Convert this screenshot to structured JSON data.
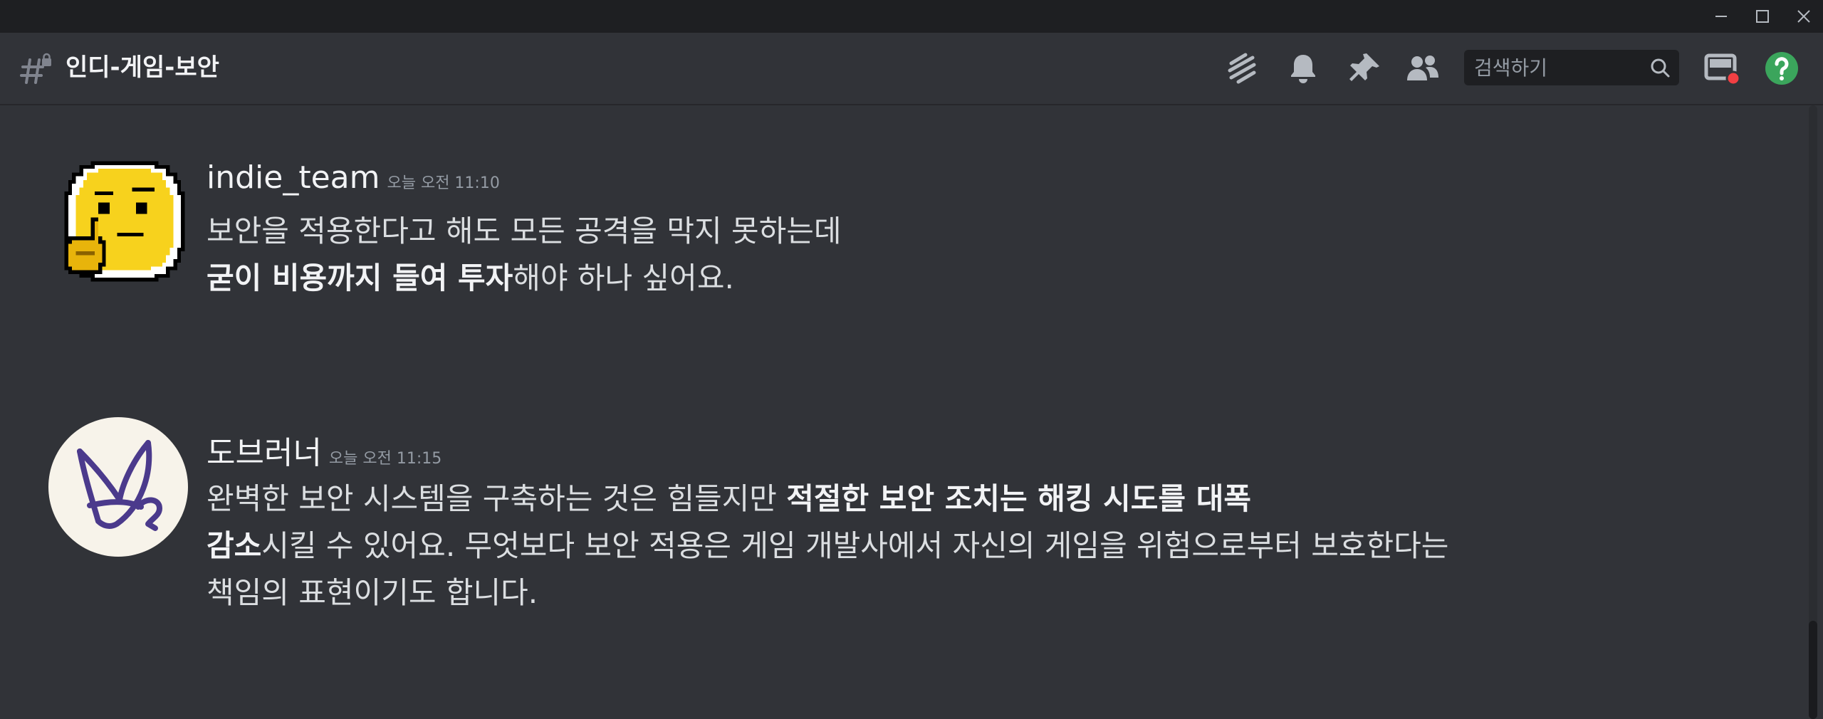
{
  "window": {
    "controls": [
      "minimize-icon",
      "maximize-icon",
      "close-icon"
    ]
  },
  "header": {
    "channel_name": "인디-게임-보안",
    "channel_icon": "hashtag-lock-icon",
    "icons": [
      "threads-icon",
      "bell-icon",
      "pin-icon",
      "members-icon",
      "inbox-icon",
      "help-icon"
    ],
    "search": {
      "placeholder": "검색하기",
      "value": ""
    }
  },
  "messages": [
    {
      "username": "indie_team",
      "timestamp": "오늘 오전 11:10",
      "avatar": "thinking-face-avatar",
      "line1": "보안을 적용한다고 해도 모든 공격을 막지 못하는데",
      "line2_bold": "굳이 비용까지 들여 투자",
      "line2_rest": "해야 하나 싶어요."
    },
    {
      "username": "도브러너",
      "timestamp": "오늘 오전 11:15",
      "avatar": "doverunner-logo-avatar",
      "line1_text": "완벽한 보안 시스템을 구축하는 것은 힘들지만 ",
      "line1_bold": "적절한 보안 조치는 해킹 시도를 대폭",
      "line2_bold": "감소",
      "line2_rest": "시킬 수 있어요. 무엇보다 보안 적용은 게임 개발사에서 자신의 게임을 위험으로부터 보호한다는",
      "line3": "책임의 표현이기도 합니다."
    }
  ],
  "colors": {
    "background": "#313338",
    "titlebar": "#1e1f22",
    "search_bg": "#1e1f22",
    "text": "#dbdee1",
    "muted": "#949ba4",
    "help_green": "#3ba55c",
    "notification_red": "#f23f43",
    "logo_purple": "#4b3a8c",
    "avatar_yellow": "#f7d21d"
  }
}
